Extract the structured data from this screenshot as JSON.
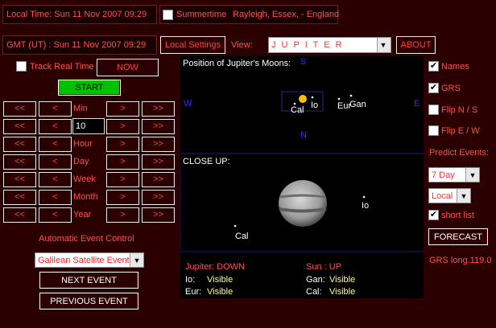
{
  "header": {
    "local_time": "Local Time: Sun 11 Nov 2007   09:29",
    "summertime_label": "Summertime",
    "summertime_checked": false,
    "location": "Rayleigh, Essex,  -  England",
    "gmt_time": "GMT (UT) : Sun 11 Nov 2007   09:29",
    "local_settings_label": "Local Settings",
    "view_label": "View:",
    "view_value": "J U P I T E R",
    "about_label": "ABOUT"
  },
  "controls": {
    "track_real_time_label": "Track Real Time",
    "now_label": "NOW",
    "start_label": "START",
    "min_value": "10",
    "rows": [
      {
        "unit": "Min",
        "b1": "<<",
        "b2": "<",
        "b3": ">",
        "b4": ">>"
      },
      {
        "unit": "",
        "b1": "<<",
        "b2": "<",
        "b3": ">",
        "b4": ">>"
      },
      {
        "unit": "Hour",
        "b1": "<<",
        "b2": "<",
        "b3": ">",
        "b4": ">>"
      },
      {
        "unit": "Day",
        "b1": "<<",
        "b2": "<",
        "b3": ">",
        "b4": ">>"
      },
      {
        "unit": "Week",
        "b1": "<<",
        "b2": "<",
        "b3": ">",
        "b4": ">>"
      },
      {
        "unit": "Month",
        "b1": "<<",
        "b2": "<",
        "b3": ">",
        "b4": ">>"
      },
      {
        "unit": "Year",
        "b1": "<<",
        "b2": "<",
        "b3": ">",
        "b4": ">>"
      }
    ],
    "auto_event_label": "Automatic Event Control",
    "event_select_value": "Galilean Satellite Event",
    "next_event_label": "NEXT EVENT",
    "previous_event_label": "PREVIOUS EVENT"
  },
  "view": {
    "moons_title": "Position of Jupiter's Moons:",
    "compass": {
      "n": "S",
      "s": "N",
      "w": "W",
      "e": "E"
    },
    "moons_labels": {
      "cal": "Cal",
      "io": "Io",
      "eur": "Eur",
      "gan": "Gan"
    },
    "closeup_title": "CLOSE UP:",
    "closeup_labels": {
      "io": "Io",
      "cal": "Cal"
    },
    "status": {
      "jupiter": "Jupiter: DOWN",
      "sun": "Sun : UP",
      "io_label": "Io:",
      "io_state": "Visible",
      "gan_label": "Gan:",
      "gan_state": "Visible",
      "eur_label": "Eur:",
      "eur_state": "Visible",
      "cal_label": "Cal:",
      "cal_state": "Visible"
    }
  },
  "options": {
    "names_label": "Names",
    "names_checked": true,
    "grs_label": "GRS",
    "grs_checked": true,
    "flip_ns_label": "Flip N / S",
    "flip_ns_checked": false,
    "flip_ew_label": "Flip E / W",
    "flip_ew_checked": false,
    "predict_label": "Predict Events:",
    "period_value": "7 Day",
    "zone_value": "Local",
    "short_list_label": "short list",
    "short_list_checked": true,
    "forecast_label": "FORECAST",
    "grs_long": "GRS long.119.0"
  },
  "colors": {
    "background": "#2a0000",
    "text_red": "#ff5050",
    "start_green": "#00c000",
    "sun_yellow": "#ffc000"
  }
}
